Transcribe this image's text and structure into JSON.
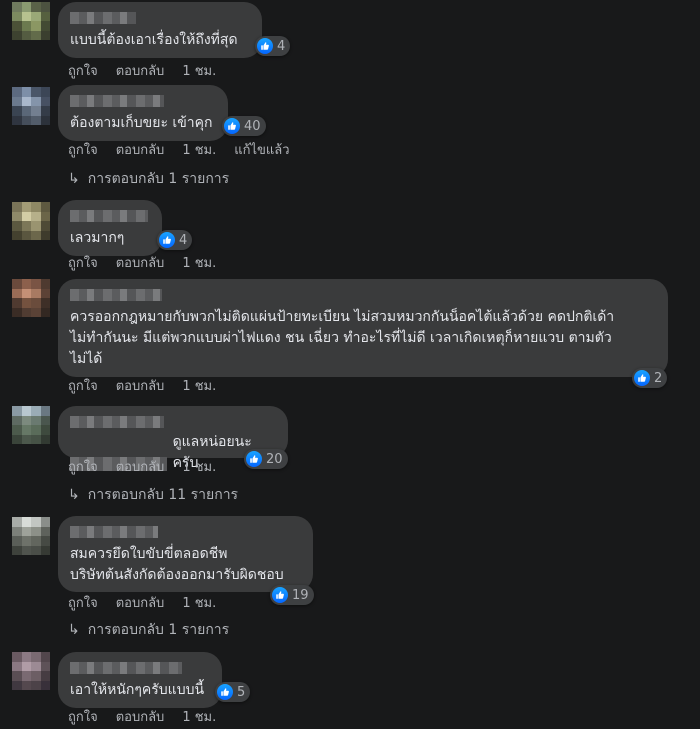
{
  "actions": {
    "like": "ถูกใจ",
    "reply": "ตอบกลับ",
    "edited": "แก้ไขแล้ว"
  },
  "colors": {
    "background": "#18191a",
    "bubble": "#3a3b3c",
    "text": "#e4e6eb",
    "muted": "#b0b3b8",
    "like_blue": "#1877f2"
  },
  "comments": [
    {
      "text": "แบบนี้ต้องเอาเรื่องให้ถึงที่สุด",
      "likes": "4",
      "time": "1 ชม.",
      "edited": false,
      "replies": ""
    },
    {
      "text": "ต้องตามเก็บขยะ เข้าคุก",
      "likes": "40",
      "time": "1 ชม.",
      "edited": true,
      "replies": "การตอบกลับ 1 รายการ"
    },
    {
      "text": "เลวมากๆ",
      "likes": "4",
      "time": "1 ชม.",
      "edited": false,
      "replies": ""
    },
    {
      "text": "ควรออกกฎหมายกับพวกไม่ติดแผ่นป้ายทะเบียน ไม่สวมหมวกกันน็อคไต้แล้วด้วย คดปกติเด้า\nไม่ทำกันนะ มีแต่พวกแบบผ่าไฟแดง ชน เฉี่ยว ทำอะไรที่ไม่ดี เวลาเกิดเหตุก็หายแวบ ตามตัว\nไม่ได้",
      "likes": "2",
      "time": "1 ชม.",
      "edited": false,
      "replies": ""
    },
    {
      "text": "ดูแลหน่อยนะครับ",
      "likes": "20",
      "time": "1 ชม.",
      "edited": false,
      "replies": "การตอบกลับ 11 รายการ"
    },
    {
      "text": "สมควรยึดใบขับขี่ตลอดชีพ\nบริษัทต้นสังกัดต้องออกมารับผิดชอบ",
      "likes": "19",
      "time": "1 ชม.",
      "edited": false,
      "replies": "การตอบกลับ 1 รายการ"
    },
    {
      "text": "เอาให้หนักๆครับแบบนี้",
      "likes": "5",
      "time": "1 ชม.",
      "edited": false,
      "replies": ""
    }
  ]
}
